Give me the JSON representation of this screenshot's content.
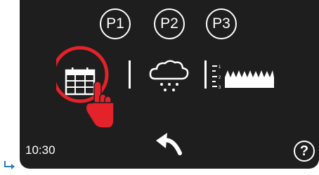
{
  "presets": [
    {
      "label": "P1",
      "icon": "preset-p1-icon"
    },
    {
      "label": "P2",
      "icon": "preset-p2-icon"
    },
    {
      "label": "P3",
      "icon": "preset-p3-icon"
    }
  ],
  "modes": [
    {
      "icon": "calendar-icon",
      "highlighted": true
    },
    {
      "icon": "rain-cloud-icon",
      "highlighted": false
    },
    {
      "icon": "sensitivity-levels-icon",
      "level_labels": [
        "1",
        "2",
        "3"
      ],
      "highlighted": false
    }
  ],
  "status": {
    "time": "10:30"
  },
  "controls": {
    "help_label": "?",
    "back_icon": "back-arrow-icon"
  },
  "overlay": {
    "pointer_icon": "tap-hand-icon",
    "highlight_color": "#e3222a"
  },
  "colors": {
    "screen": "#1e1e1e",
    "foreground": "#ffffff",
    "accent": "#e3222a",
    "corner_arrow": "#2b7cc0"
  }
}
